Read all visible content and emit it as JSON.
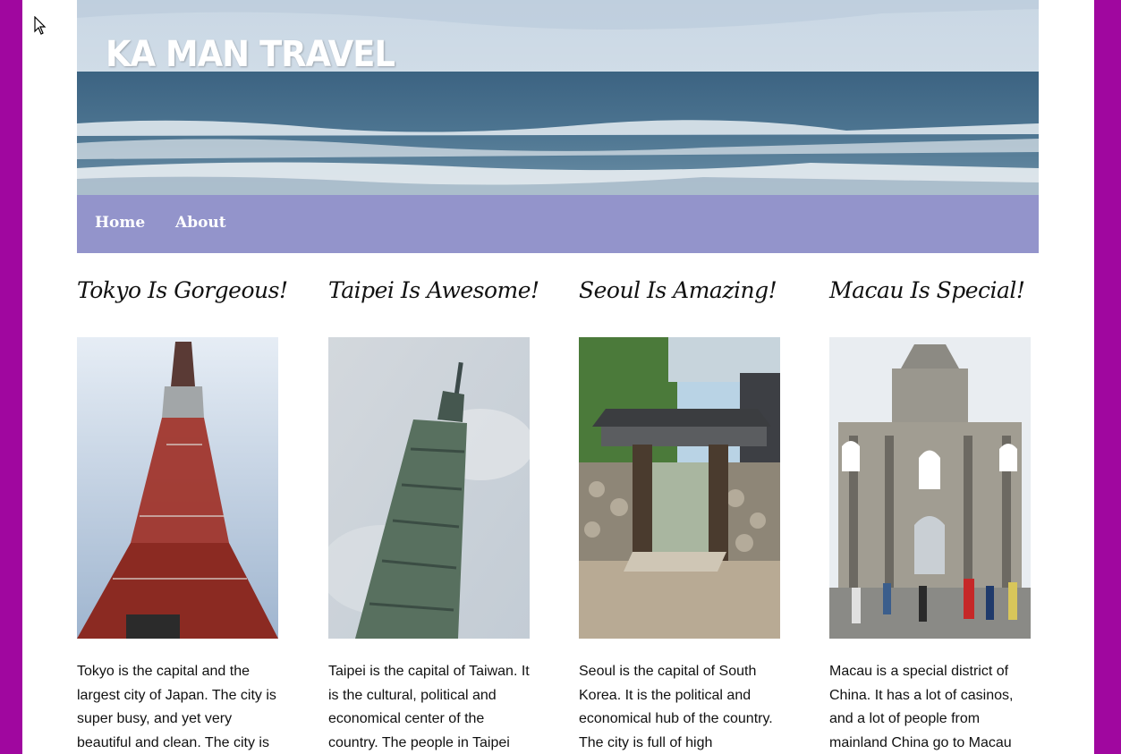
{
  "site": {
    "title": "KA MAN TRAVEL"
  },
  "nav": {
    "items": [
      {
        "label": "Home"
      },
      {
        "label": "About"
      }
    ]
  },
  "posts": [
    {
      "title": "Tokyo Is Gorgeous!",
      "body": "Tokyo is the capital and the largest city of Japan. The city is super busy, and yet very beautiful and clean. The city is"
    },
    {
      "title": "Taipei Is Awesome!",
      "body": "Taipei is the capital of Taiwan. It is the cultural, political and economical center of the country. The people in Taipei"
    },
    {
      "title": "Seoul Is Amazing!",
      "body": "Seoul is the capital of South Korea. It is the political and economical hub of the country. The city is full of high"
    },
    {
      "title": "Macau Is Special!",
      "body": "Macau is a special district of China. It has a lot of casinos, and a lot of people from mainland China go to Macau"
    }
  ],
  "colors": {
    "outer_background": "#a0079f",
    "nav_background": "#9394cb",
    "page_background": "#ffffff"
  },
  "icons": [
    "mouse-pointer-icon"
  ]
}
